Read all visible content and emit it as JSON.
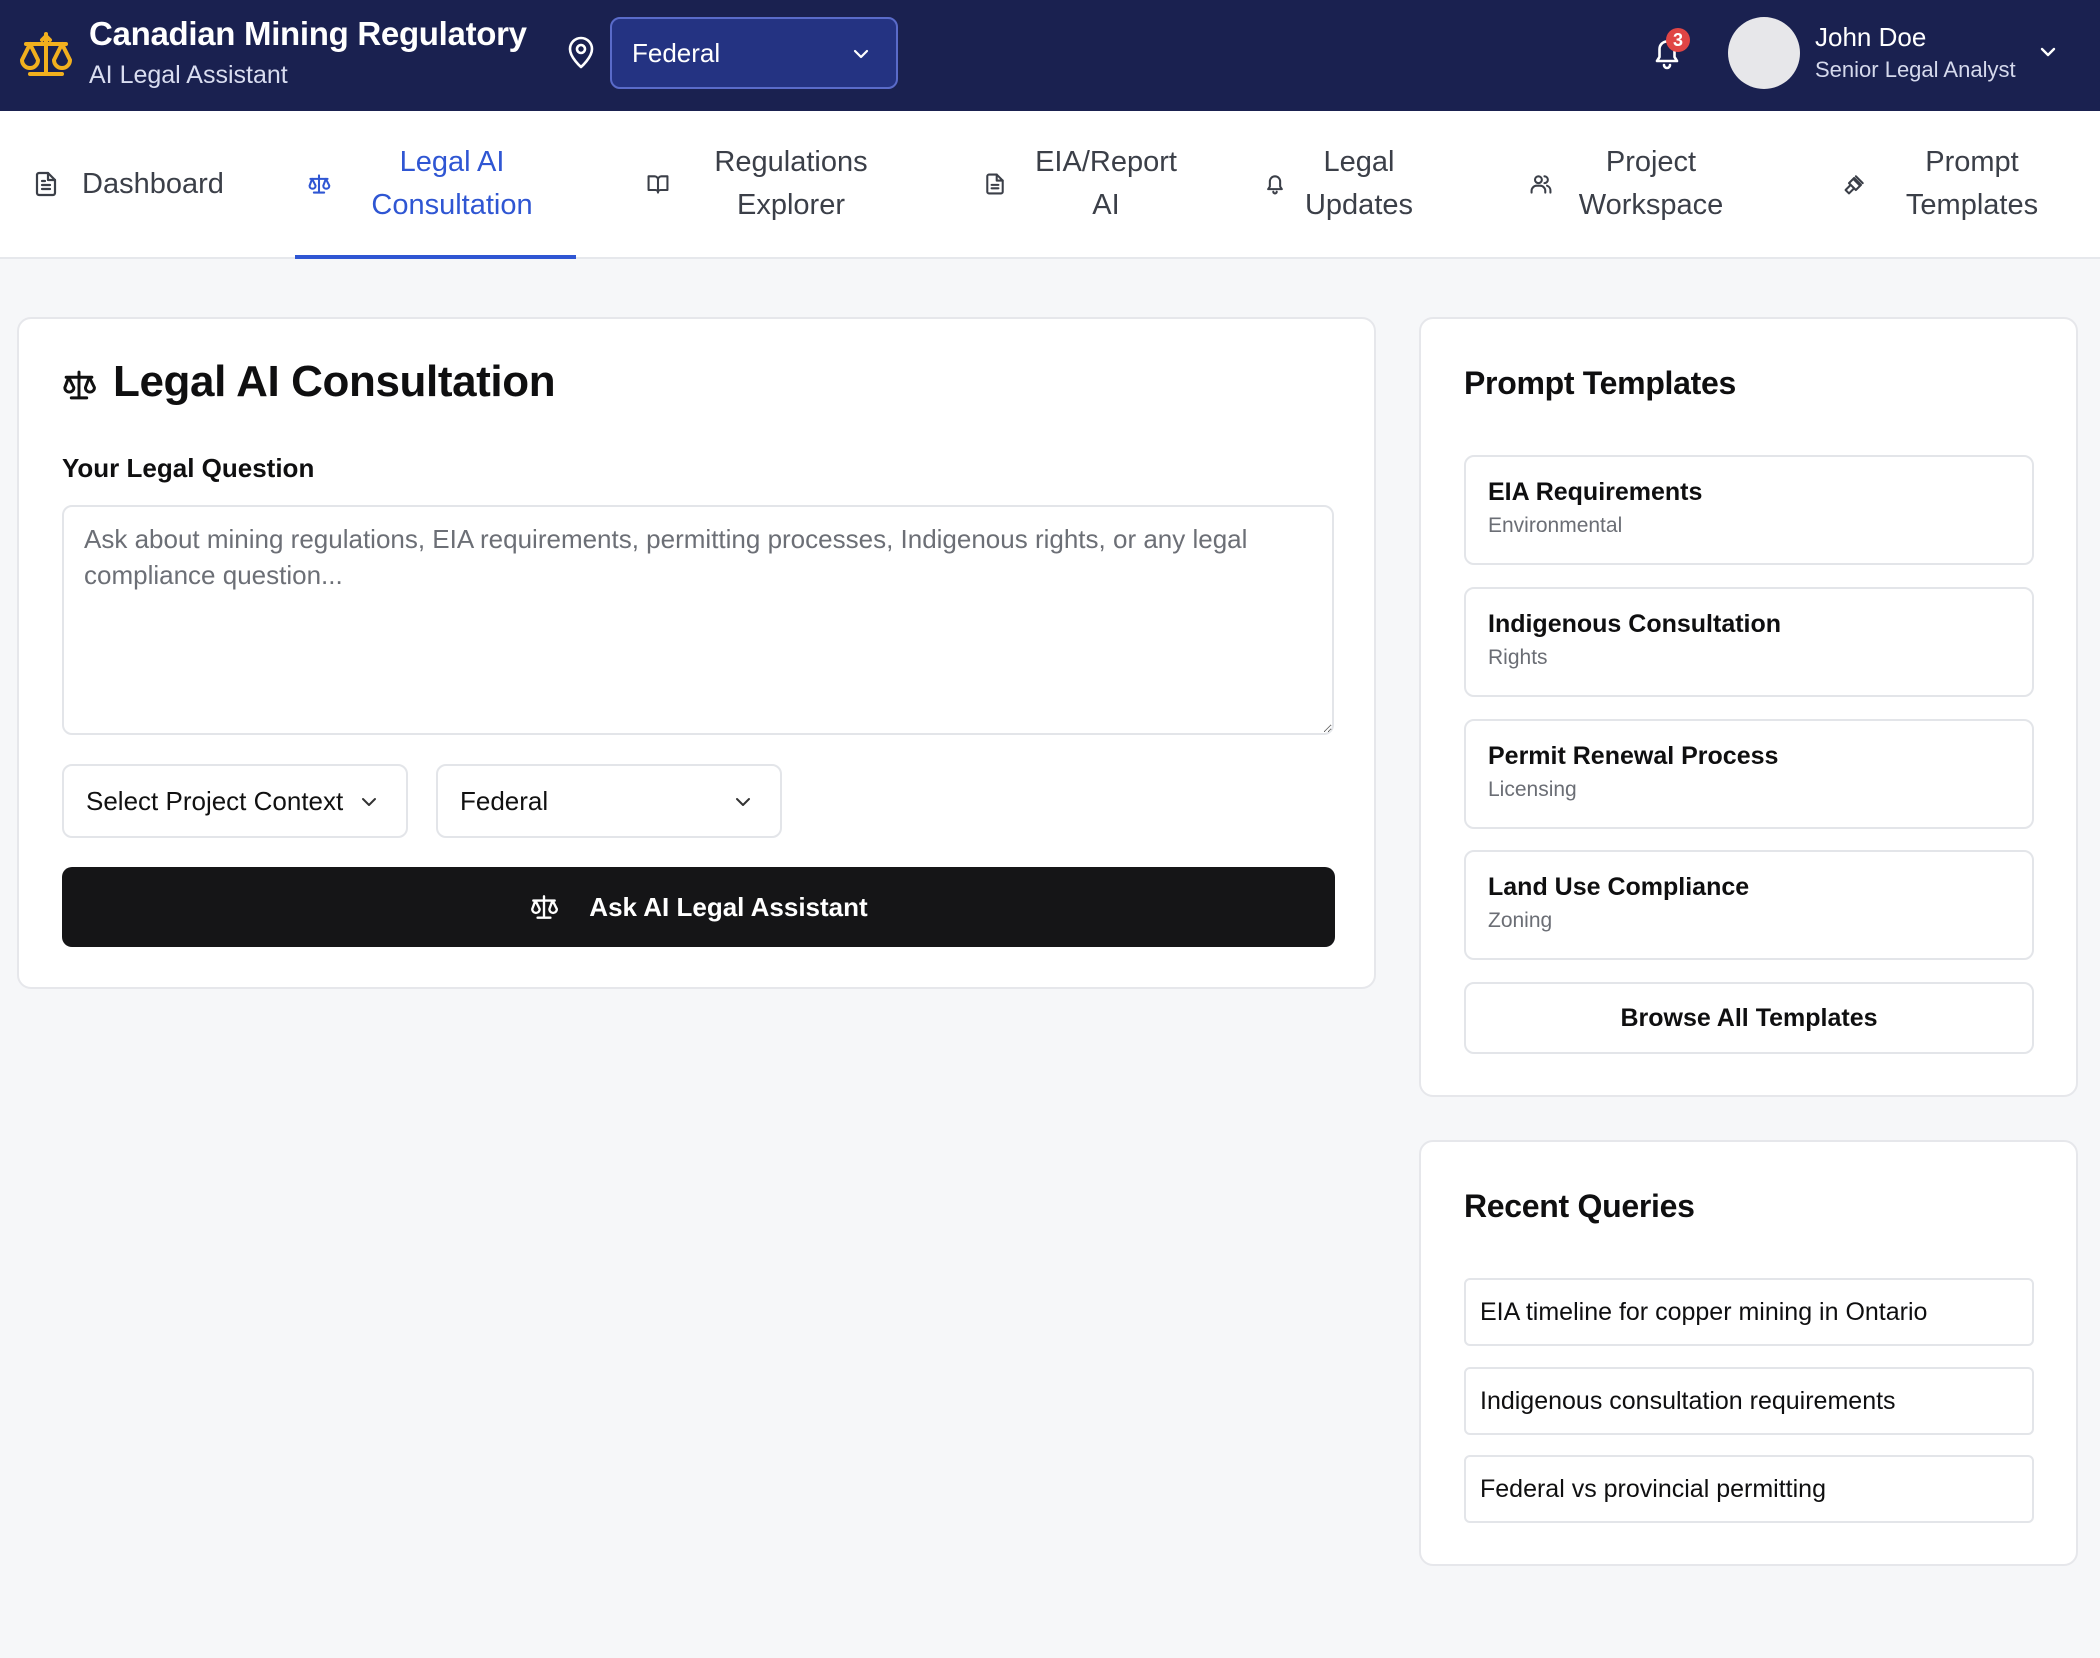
{
  "app": {
    "title": "Canadian Mining Regulatory",
    "subtitle": "AI Legal Assistant",
    "jurisdiction": "Federal",
    "notification_count": "3",
    "user": {
      "name": "John Doe",
      "role": "Senior Legal Analyst"
    }
  },
  "tabs": [
    {
      "label": "Dashboard",
      "icon": "document-icon"
    },
    {
      "label": "Legal AI Consultation",
      "icon": "scale-icon"
    },
    {
      "label": "Regulations Explorer",
      "icon": "book-icon"
    },
    {
      "label": "EIA/Report AI",
      "icon": "document-icon"
    },
    {
      "label": "Legal Updates",
      "icon": "bell-icon"
    },
    {
      "label": "Project Workspace",
      "icon": "users-icon"
    },
    {
      "label": "Prompt Templates",
      "icon": "gavel-icon"
    }
  ],
  "consultation": {
    "title": "Legal AI Consultation",
    "question_label": "Your Legal Question",
    "question_placeholder": "Ask about mining regulations, EIA requirements, permitting processes, Indigenous rights, or any legal compliance question...",
    "project_context": "Select Project Context",
    "jurisdiction": "Federal",
    "ask_button": "Ask AI Legal Assistant"
  },
  "prompt_templates": {
    "title": "Prompt Templates",
    "items": [
      {
        "name": "EIA Requirements",
        "category": "Environmental"
      },
      {
        "name": "Indigenous Consultation",
        "category": "Rights"
      },
      {
        "name": "Permit Renewal Process",
        "category": "Licensing"
      },
      {
        "name": "Land Use Compliance",
        "category": "Zoning"
      }
    ],
    "browse_button": "Browse All Templates"
  },
  "recent_queries": {
    "title": "Recent Queries",
    "items": [
      "EIA timeline for copper mining in Ontario",
      "Indigenous consultation requirements",
      "Federal vs provincial permitting"
    ]
  },
  "colors": {
    "header_bg": "#1a2150",
    "accent": "#2f56d3",
    "logo": "#f2b01e",
    "badge": "#e04545",
    "primary_button": "#151517"
  }
}
